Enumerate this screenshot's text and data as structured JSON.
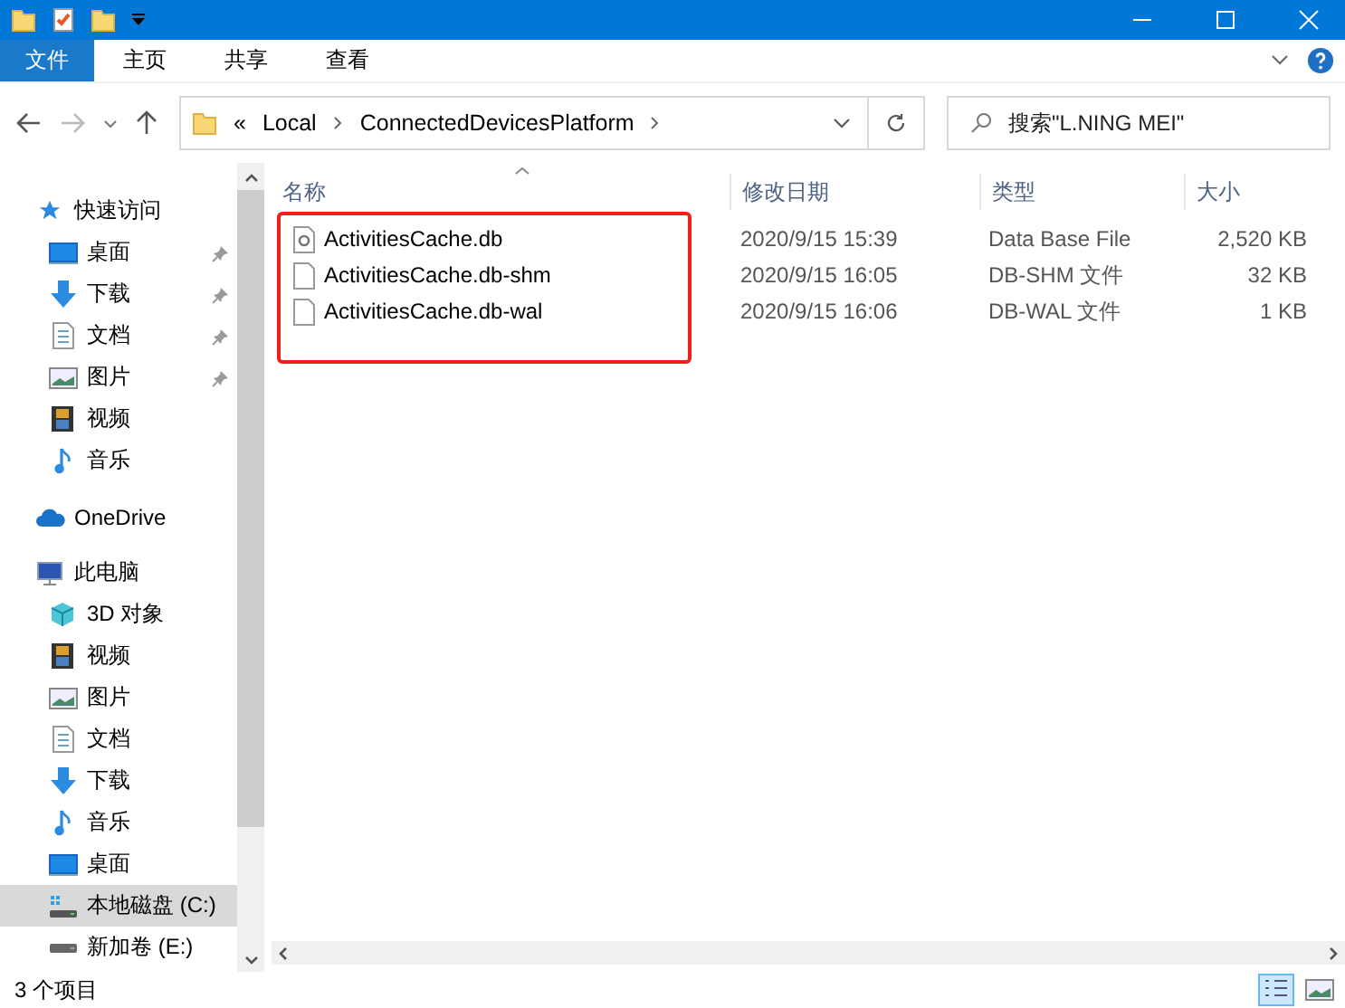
{
  "ribbon_tabs": [
    {
      "label": "文件",
      "selected": true
    },
    {
      "label": "主页",
      "selected": false
    },
    {
      "label": "共享",
      "selected": false
    },
    {
      "label": "查看",
      "selected": false
    }
  ],
  "address": {
    "crumbs": [
      "Local",
      "ConnectedDevicesPlatform"
    ],
    "overflow": "«"
  },
  "search": {
    "placeholder": "搜索\"L.NING MEI\""
  },
  "sidebar": {
    "items": [
      {
        "label": "快速访问",
        "kind": "star",
        "selected": false,
        "children": [
          {
            "label": "桌面",
            "kind": "desktop",
            "pinned": true,
            "selected": false
          },
          {
            "label": "下载",
            "kind": "download",
            "pinned": true,
            "selected": false
          },
          {
            "label": "文档",
            "kind": "document",
            "pinned": true,
            "selected": false
          },
          {
            "label": "图片",
            "kind": "pictures",
            "pinned": true,
            "selected": false
          },
          {
            "label": "视频",
            "kind": "video",
            "pinned": false,
            "selected": false
          },
          {
            "label": "音乐",
            "kind": "music",
            "pinned": false,
            "selected": false
          }
        ]
      },
      {
        "label": "OneDrive",
        "kind": "cloud",
        "selected": false
      },
      {
        "label": "此电脑",
        "kind": "pc",
        "selected": false,
        "children": [
          {
            "label": "3D 对象",
            "kind": "cube",
            "pinned": false,
            "selected": false
          },
          {
            "label": "视频",
            "kind": "video",
            "pinned": false,
            "selected": false
          },
          {
            "label": "图片",
            "kind": "pictures",
            "pinned": false,
            "selected": false
          },
          {
            "label": "文档",
            "kind": "document",
            "pinned": false,
            "selected": false
          },
          {
            "label": "下载",
            "kind": "download",
            "pinned": false,
            "selected": false
          },
          {
            "label": "音乐",
            "kind": "music",
            "pinned": false,
            "selected": false
          },
          {
            "label": "桌面",
            "kind": "desktop",
            "pinned": false,
            "selected": false
          },
          {
            "label": "本地磁盘 (C:)",
            "kind": "system-drive",
            "pinned": false,
            "selected": true
          },
          {
            "label": "新加卷 (E:)",
            "kind": "drive",
            "pinned": false,
            "selected": false
          }
        ]
      }
    ]
  },
  "table": {
    "columns": [
      "名称",
      "修改日期",
      "类型",
      "大小"
    ],
    "rows": [
      {
        "name": "ActivitiesCache.db",
        "kind": "settings-file",
        "modified": "2020/9/15 15:39",
        "type": "Data Base File",
        "size": "2,520 KB"
      },
      {
        "name": "ActivitiesCache.db-shm",
        "kind": "file",
        "modified": "2020/9/15 16:05",
        "type": "DB-SHM 文件",
        "size": "32 KB"
      },
      {
        "name": "ActivitiesCache.db-wal",
        "kind": "file",
        "modified": "2020/9/15 16:06",
        "type": "DB-WAL 文件",
        "size": "1 KB"
      }
    ]
  },
  "status_bar": {
    "count": "3 个项目"
  }
}
